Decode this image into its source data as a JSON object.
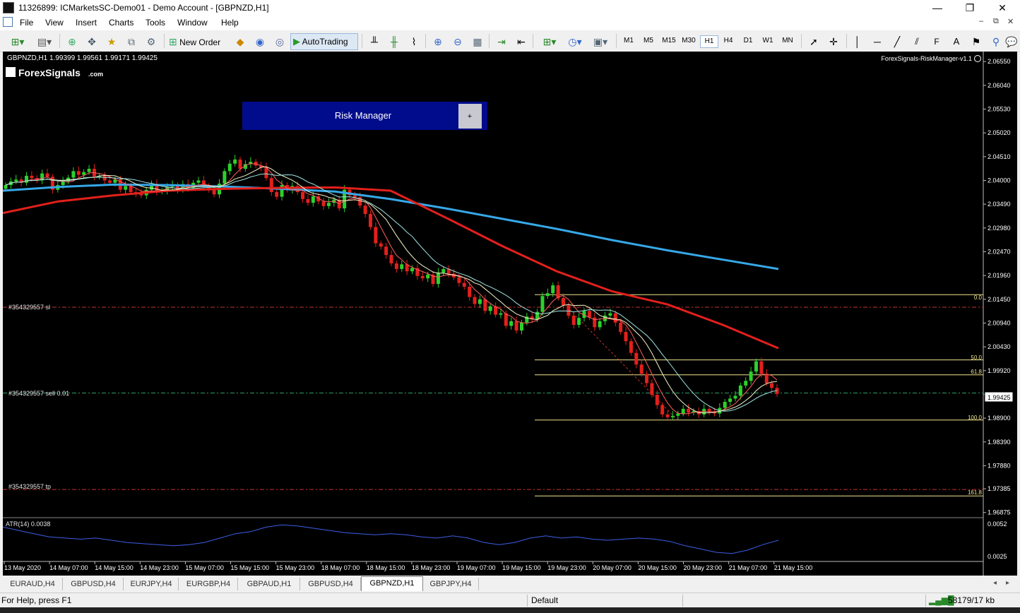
{
  "window": {
    "title": "11326899: ICMarketsSC-Demo01 - Demo Account - [GBPNZD,H1]",
    "minimize": "—",
    "maximize": "❐",
    "close": "✕"
  },
  "menu": {
    "items": [
      "File",
      "View",
      "Insert",
      "Charts",
      "Tools",
      "Window",
      "Help"
    ],
    "mdi_min": "–",
    "mdi_restore": "⧉",
    "mdi_close": "✕"
  },
  "toolbar": {
    "new_order": "New Order",
    "autotrading": "AutoTrading",
    "timeframes": [
      "M1",
      "M5",
      "M15",
      "M30",
      "H1",
      "H4",
      "D1",
      "W1",
      "MN"
    ],
    "selected_timeframe": "H1"
  },
  "chart": {
    "info": "GBPNZD,H1  1.99399 1.99561 1.99171 1.99425",
    "brand": "ForexSignals",
    "brand_suffix": ".com",
    "ea_name": "ForexSignals-RiskManager-v1.1",
    "risk_manager_label": "Risk Manager",
    "risk_manager_plus": "+",
    "current_price": "1.99425",
    "order_lines": {
      "sl": "#354329557 sl",
      "sell": "#354329557 sell 0.01",
      "tp": "#354329557 tp"
    },
    "fib_levels": [
      "0.0",
      "50.0",
      "61.8",
      "100.0",
      "161.8"
    ],
    "atr_label": "ATR(14) 0.0038",
    "atr_scale": [
      "0.0052",
      "0.0025"
    ],
    "colors": {
      "background": "#000000",
      "bull": "#2bd12b",
      "bear": "#e3201b",
      "ma_red": "#e3201b",
      "ma_blue": "#36a8e8",
      "fib": "#f0e68c",
      "order_sl_tp": "#c83232",
      "order_entry": "#2f9e6a",
      "atr": "#3c5ee6",
      "risk_manager": "#000c8c"
    }
  },
  "chart_data": {
    "type": "candlestick",
    "symbol": "GBPNZD",
    "timeframe": "H1",
    "y_axis_ticks": [
      "2.06550",
      "2.06040",
      "2.05530",
      "2.05020",
      "2.04510",
      "2.04000",
      "2.03490",
      "2.02980",
      "2.02470",
      "2.01960",
      "2.01450",
      "2.00940",
      "2.00430",
      "1.99920",
      "1.99410",
      "1.98900",
      "1.98390",
      "1.97880",
      "1.97385",
      "1.96875"
    ],
    "ylim": [
      1.96765,
      2.06765
    ],
    "x_axis_ticks": [
      "13 May 2020",
      "14 May 07:00",
      "14 May 15:00",
      "14 May 23:00",
      "15 May 07:00",
      "15 May 15:00",
      "15 May 23:00",
      "18 May 07:00",
      "18 May 15:00",
      "18 May 23:00",
      "19 May 07:00",
      "19 May 15:00",
      "19 May 23:00",
      "20 May 07:00",
      "20 May 15:00",
      "20 May 23:00",
      "21 May 07:00",
      "21 May 15:00"
    ],
    "last_ohlc": {
      "open": 1.99399,
      "high": 1.99561,
      "low": 1.99171,
      "close": 1.99425
    },
    "fib_prices": {
      "0.0": 2.0155,
      "50.0": 2.0015,
      "61.8": 1.9983,
      "100.0": 1.9886,
      "161.8": 1.9723
    },
    "order_prices": {
      "sl": 2.0128,
      "sell": 1.9944,
      "tp": 1.9737
    },
    "series": [
      {
        "name": "close",
        "values": [
          2.039,
          2.0398,
          2.0402,
          2.0395,
          2.041,
          2.0405,
          2.04,
          2.0415,
          2.0408,
          2.038,
          2.039,
          2.0398,
          2.0406,
          2.042,
          2.0412,
          2.0418,
          2.0425,
          2.0408,
          2.041,
          2.04,
          2.0395,
          2.0402,
          2.038,
          2.0388,
          2.0375,
          2.0372,
          2.0368,
          2.038,
          2.0392,
          2.0376,
          2.0378,
          2.0386,
          2.039,
          2.038,
          2.0392,
          2.0384,
          2.0395,
          2.04,
          2.0388,
          2.0382,
          2.037,
          2.0393,
          2.042,
          2.0436,
          2.0445,
          2.0425,
          2.0435,
          2.044,
          2.0432,
          2.0428,
          2.0405,
          2.0375,
          2.0365,
          2.039,
          2.038,
          2.0388,
          2.0375,
          2.036,
          2.0352,
          2.0366,
          2.0355,
          2.0345,
          2.0352,
          2.0359,
          2.034,
          2.038,
          2.0368,
          2.0364,
          2.0346,
          2.0328,
          2.03,
          2.0265,
          2.0258,
          2.024,
          2.0222,
          2.021,
          2.022,
          2.0205,
          2.0212,
          2.0195,
          2.019,
          2.0198,
          2.0178,
          2.0202,
          2.021,
          2.02,
          2.0192,
          2.018,
          2.0172,
          2.015,
          2.0135,
          2.0145,
          2.012,
          2.013,
          2.0112,
          2.0115,
          2.0088,
          2.0098,
          2.0078,
          2.0095,
          2.0108,
          2.0102,
          2.0118,
          2.0152,
          2.0158,
          2.0175,
          2.0148,
          2.0132,
          2.011,
          2.009,
          2.0105,
          2.012,
          2.0106,
          2.0085,
          2.0098,
          2.011,
          2.0115,
          2.0095,
          2.0075,
          2.0055,
          2.003,
          2.0005,
          1.9985,
          1.9965,
          1.994,
          1.9918,
          1.9898,
          1.9892,
          1.9895,
          1.99,
          1.991,
          1.9902,
          1.9905,
          1.9898,
          1.991,
          1.9904,
          1.99,
          1.9912,
          1.9925,
          1.9932,
          1.9938,
          1.996,
          1.997,
          1.999,
          2.0012,
          1.9985,
          1.9965,
          1.9955,
          1.9942
        ]
      },
      {
        "name": "MA blue",
        "values": [
          2.0378,
          2.0386,
          2.0391,
          2.039,
          2.0387,
          2.0382,
          2.0376,
          2.036,
          2.034,
          2.0318,
          2.0296,
          2.0272,
          2.025,
          2.023,
          2.021
        ]
      },
      {
        "name": "MA red",
        "values": [
          2.033,
          2.0355,
          2.0368,
          2.0378,
          2.0382,
          2.0384,
          2.0385,
          2.0378,
          2.032,
          2.026,
          2.0205,
          2.0162,
          2.0134,
          2.009,
          2.004
        ]
      }
    ],
    "atr_values": [
      0.005,
      0.0047,
      0.0044,
      0.0041,
      0.004,
      0.0039,
      0.004,
      0.0038,
      0.0036,
      0.0035,
      0.0034,
      0.0033,
      0.0034,
      0.0036,
      0.004,
      0.0044,
      0.0046,
      0.005,
      0.0052,
      0.0051,
      0.0049,
      0.0047,
      0.0045,
      0.0044,
      0.0043,
      0.0044,
      0.0043,
      0.0041,
      0.004,
      0.0042,
      0.004,
      0.0036,
      0.0034,
      0.0036,
      0.004,
      0.0042,
      0.004,
      0.0041,
      0.0039,
      0.0038,
      0.0039,
      0.004,
      0.0039,
      0.0037,
      0.0033,
      0.003,
      0.0027,
      0.0026,
      0.0029,
      0.0034,
      0.0038
    ]
  },
  "tabs": [
    "EURAUD,H4",
    "GBPUSD,H4",
    "EURJPY,H4",
    "EURGBP,H4",
    "GBPAUD,H1",
    "GBPUSD,H4",
    "GBPNZD,H1",
    "GBPJPY,H4"
  ],
  "active_tab": "GBPNZD,H1",
  "status": {
    "help": "For Help, press F1",
    "profile": "Default",
    "traffic": "58179/17 kb"
  }
}
